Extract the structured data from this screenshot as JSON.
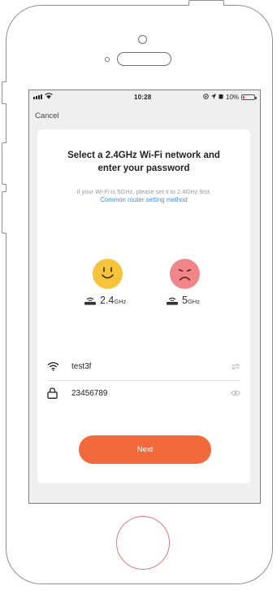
{
  "status_bar": {
    "time": "10:28",
    "battery": "10%"
  },
  "nav": {
    "cancel_label": "Cancel"
  },
  "content": {
    "title_line1": "Select a 2.4GHz Wi-Fi network and",
    "title_line2": "enter your password",
    "hint": "If your Wi-Fi is 5GHz, please set it to 2.4GHz first.",
    "link": "Common router setting method"
  },
  "bands": [
    {
      "big": "2.4",
      "small": "GHz",
      "icon": "smiley-face-icon",
      "color": "#f5c33c"
    },
    {
      "big": "5",
      "small": "GHz",
      "icon": "sad-face-icon",
      "color": "#f0868a"
    }
  ],
  "form": {
    "ssid": "test3f",
    "password": "23456789",
    "icons": {
      "ssid": "wifi-icon",
      "password": "lock-icon",
      "switch": "switch-network-icon",
      "reveal": "eye-icon"
    }
  },
  "actions": {
    "next_label": "Next",
    "accent": "#f26a3b"
  }
}
